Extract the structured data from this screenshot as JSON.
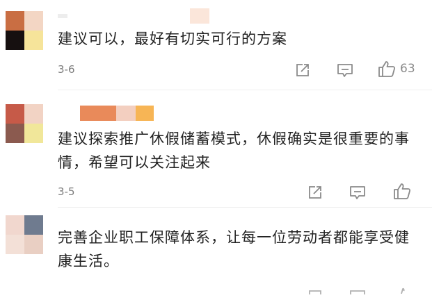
{
  "colors": {
    "text": "#222222",
    "meta": "#7d7d7d",
    "icon": "#8a8a8a",
    "background": "#ffffff"
  },
  "comments": [
    {
      "text": "建议可以，最好有切实可行的方案",
      "date": "3-6",
      "like_count": "63",
      "actions": [
        "share-icon",
        "comment-icon",
        "like-icon"
      ]
    },
    {
      "text": "建议探索推广休假储蓄模式，休假确实是很重要的事情，希望可以关注起来",
      "date": "3-5",
      "like_count": "",
      "actions": [
        "share-icon",
        "comment-icon",
        "like-icon"
      ]
    },
    {
      "text": "完善企业职工保障体系，让每一位劳动者都能享受健康生活。",
      "date": "",
      "like_count": "",
      "actions": []
    }
  ]
}
